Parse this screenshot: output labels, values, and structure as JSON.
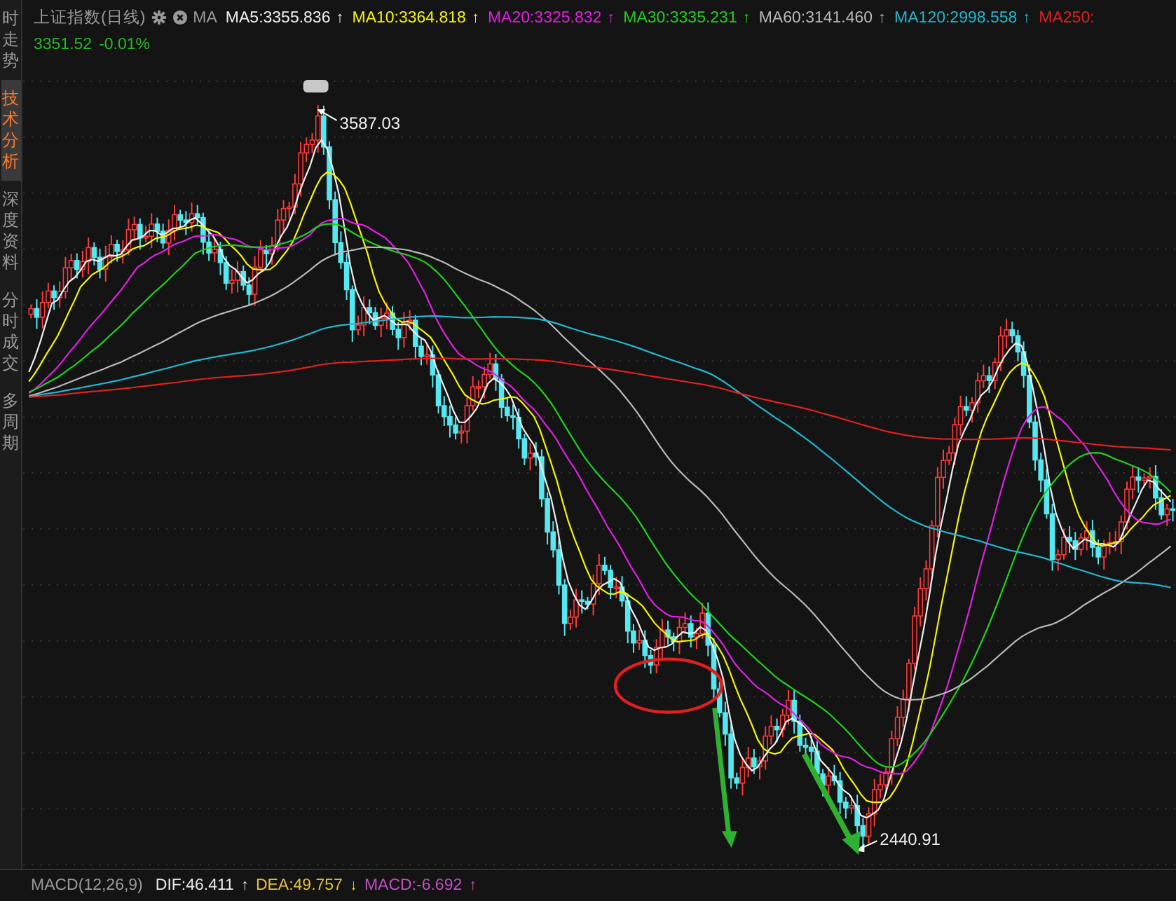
{
  "sidebar": {
    "tabs": [
      {
        "label": "时走势",
        "selected": false
      },
      {
        "label": "技术分析",
        "selected": true
      },
      {
        "label": "深度资料",
        "selected": false
      },
      {
        "label": "分时成交",
        "selected": false
      },
      {
        "label": "多周期",
        "selected": false
      }
    ]
  },
  "header": {
    "title": "上证指数(日线)",
    "indicator": "MA",
    "price": "3351.52",
    "change": "-0.01%",
    "ma_lines": [
      {
        "label": "MA5:3355.836",
        "arrow": "↑",
        "color": "#f0f0f0"
      },
      {
        "label": "MA10:3364.818",
        "arrow": "↑",
        "color": "#f5f500"
      },
      {
        "label": "MA20:3325.832",
        "arrow": "↑",
        "color": "#e020e0"
      },
      {
        "label": "MA30:3335.231",
        "arrow": "↑",
        "color": "#20d020"
      },
      {
        "label": "MA60:3141.460",
        "arrow": "↑",
        "color": "#b8b8b8"
      },
      {
        "label": "MA120:2998.558",
        "arrow": "↑",
        "color": "#20b8d0"
      },
      {
        "label": "MA250:",
        "color": "#e02020"
      }
    ]
  },
  "chart": {
    "high_label": "3587.03",
    "low_label": "2440.91"
  },
  "macd": {
    "title": "MACD(12,26,9)",
    "values": [
      {
        "label": "DIF:46.411",
        "arrow": "↑",
        "color": "#e8e8e8"
      },
      {
        "label": "DEA:49.757",
        "arrow": "↓",
        "color": "#e8c040"
      },
      {
        "label": "MACD:-6.692",
        "arrow": "↑",
        "color": "#c050c0"
      }
    ]
  }
}
